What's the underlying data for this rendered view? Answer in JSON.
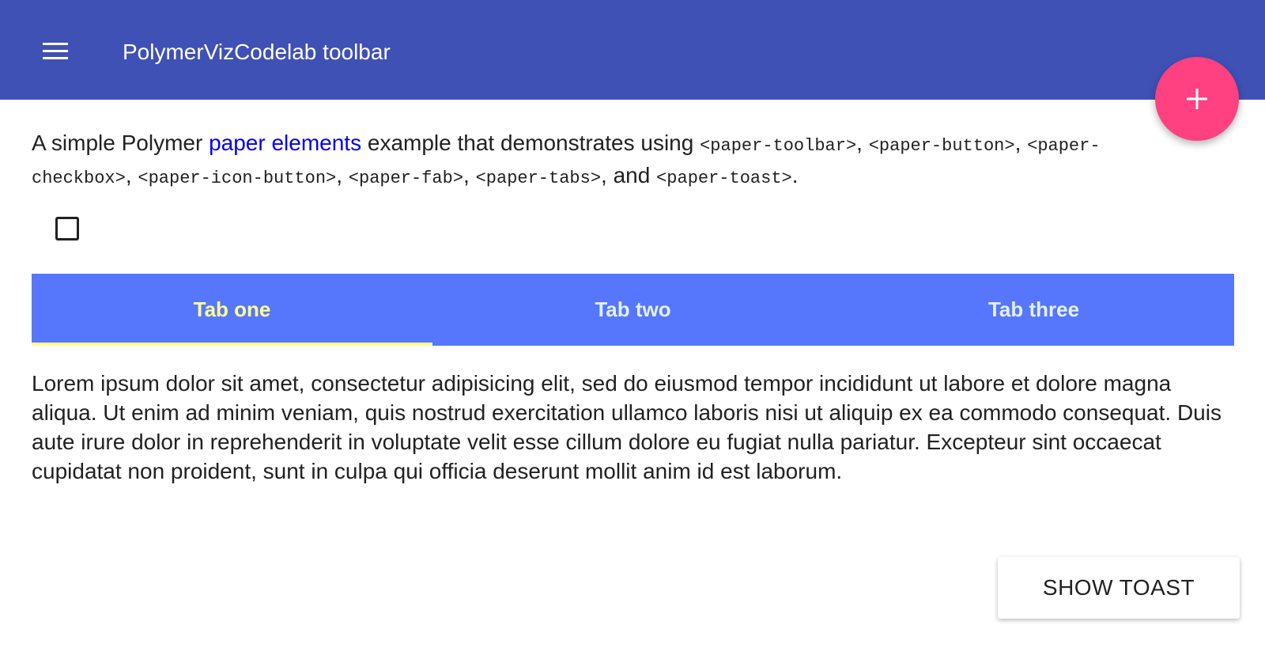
{
  "toolbar": {
    "title": "PolymerVizCodelab toolbar",
    "menu_icon": "menu-icon",
    "background": "#3f51b5"
  },
  "fab": {
    "icon": "plus-icon",
    "color": "#ff4081"
  },
  "intro": {
    "text_before": "A simple Polymer ",
    "link_text": "paper elements",
    "text_after_link": " example that demonstrates using ",
    "elements": [
      "<paper-toolbar>",
      "<paper-button>",
      "<paper-checkbox>",
      "<paper-icon-button>",
      "<paper-fab>",
      "<paper-tabs>",
      "<paper-toast>"
    ],
    "sep": ", ",
    "and": ", and ",
    "end": "."
  },
  "checkbox": {
    "checked": false
  },
  "tabs": {
    "background": "#5677fc",
    "selected_color": "#ffff8d",
    "items": [
      {
        "label": "Tab one",
        "selected": true
      },
      {
        "label": "Tab two",
        "selected": false
      },
      {
        "label": "Tab three",
        "selected": false
      }
    ]
  },
  "content": {
    "lorem": "Lorem ipsum dolor sit amet, consectetur adipisicing elit, sed do eiusmod tempor incididunt ut labore et dolore magna aliqua. Ut enim ad minim veniam, quis nostrud exercitation ullamco laboris nisi ut aliquip ex ea commodo consequat. Duis aute irure dolor in reprehenderit in voluptate velit esse cillum dolore eu fugiat nulla pariatur. Excepteur sint occaecat cupidatat non proident, sunt in culpa qui officia deserunt mollit anim id est laborum."
  },
  "toast_button": {
    "label": "SHOW TOAST"
  }
}
